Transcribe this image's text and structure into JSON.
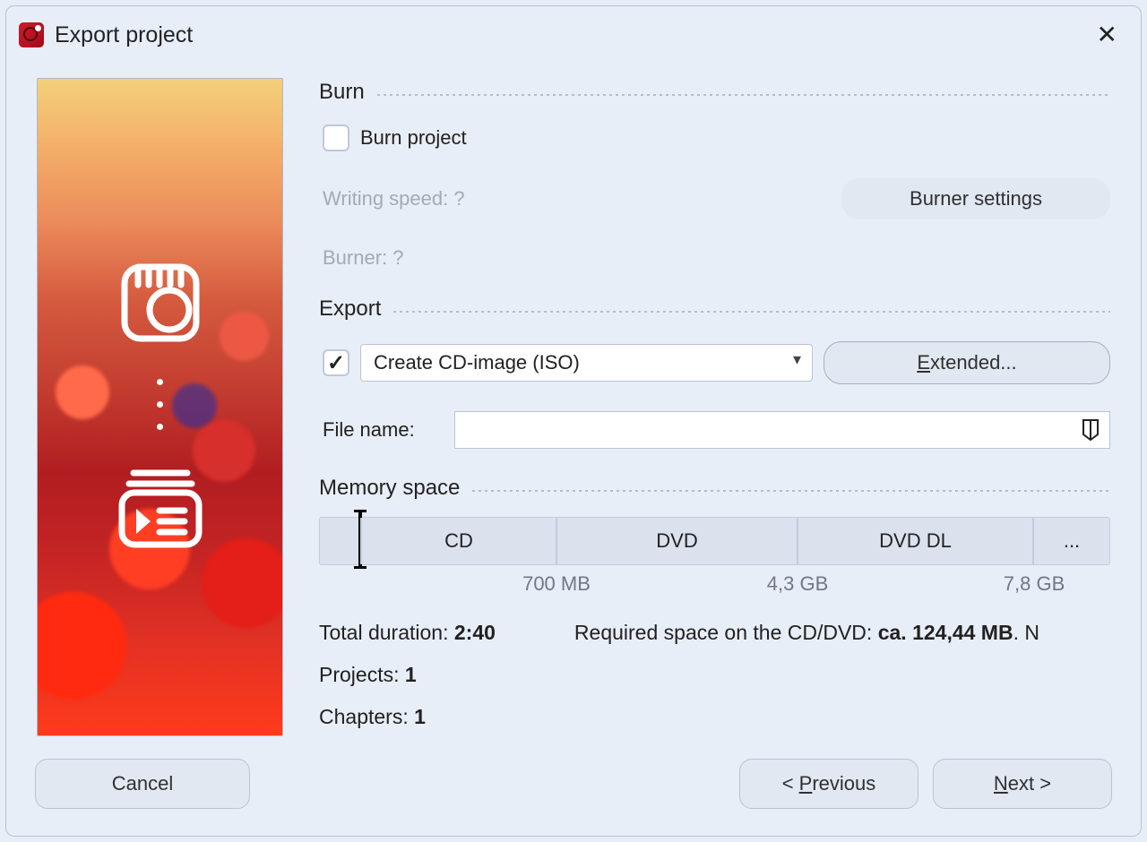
{
  "title": "Export project",
  "burn": {
    "section": "Burn",
    "checkbox_label": "Burn project",
    "writing_speed_label": "Writing speed: ?",
    "burner_label": "Burner: ?",
    "burner_settings_btn": "Burner settings"
  },
  "export": {
    "section": "Export",
    "select_value": "Create CD-image (ISO)",
    "extended_btn": "Extended...",
    "filename_label": "File name:"
  },
  "memory": {
    "section": "Memory space",
    "seg_cd": "CD",
    "seg_dvd": "DVD",
    "seg_dvddl": "DVD DL",
    "seg_more": "...",
    "tick_700": "700 MB",
    "tick_43": "4,3 GB",
    "tick_78": "7,8 GB"
  },
  "stats": {
    "total_duration_label": "Total duration: ",
    "total_duration_value": "2:40",
    "projects_label": "Projects: ",
    "projects_value": "1",
    "chapters_label": "Chapters: ",
    "chapters_value": "1",
    "required_label": "Required space on the CD/DVD: ",
    "required_value": "ca. 124,44 MB",
    "required_suffix": ". N"
  },
  "footer": {
    "cancel": "Cancel",
    "prev": "Previous",
    "next": "Next"
  }
}
